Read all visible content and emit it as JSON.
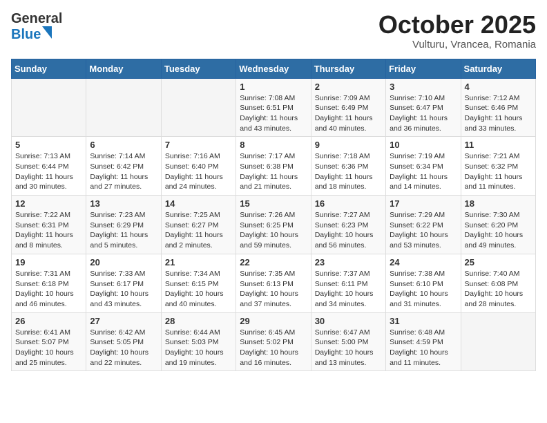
{
  "header": {
    "logo_general": "General",
    "logo_blue": "Blue",
    "month_title": "October 2025",
    "subtitle": "Vulturu, Vrancea, Romania"
  },
  "days_of_week": [
    "Sunday",
    "Monday",
    "Tuesday",
    "Wednesday",
    "Thursday",
    "Friday",
    "Saturday"
  ],
  "weeks": [
    [
      {
        "day": "",
        "info": ""
      },
      {
        "day": "",
        "info": ""
      },
      {
        "day": "",
        "info": ""
      },
      {
        "day": "1",
        "info": "Sunrise: 7:08 AM\nSunset: 6:51 PM\nDaylight: 11 hours\nand 43 minutes."
      },
      {
        "day": "2",
        "info": "Sunrise: 7:09 AM\nSunset: 6:49 PM\nDaylight: 11 hours\nand 40 minutes."
      },
      {
        "day": "3",
        "info": "Sunrise: 7:10 AM\nSunset: 6:47 PM\nDaylight: 11 hours\nand 36 minutes."
      },
      {
        "day": "4",
        "info": "Sunrise: 7:12 AM\nSunset: 6:46 PM\nDaylight: 11 hours\nand 33 minutes."
      }
    ],
    [
      {
        "day": "5",
        "info": "Sunrise: 7:13 AM\nSunset: 6:44 PM\nDaylight: 11 hours\nand 30 minutes."
      },
      {
        "day": "6",
        "info": "Sunrise: 7:14 AM\nSunset: 6:42 PM\nDaylight: 11 hours\nand 27 minutes."
      },
      {
        "day": "7",
        "info": "Sunrise: 7:16 AM\nSunset: 6:40 PM\nDaylight: 11 hours\nand 24 minutes."
      },
      {
        "day": "8",
        "info": "Sunrise: 7:17 AM\nSunset: 6:38 PM\nDaylight: 11 hours\nand 21 minutes."
      },
      {
        "day": "9",
        "info": "Sunrise: 7:18 AM\nSunset: 6:36 PM\nDaylight: 11 hours\nand 18 minutes."
      },
      {
        "day": "10",
        "info": "Sunrise: 7:19 AM\nSunset: 6:34 PM\nDaylight: 11 hours\nand 14 minutes."
      },
      {
        "day": "11",
        "info": "Sunrise: 7:21 AM\nSunset: 6:32 PM\nDaylight: 11 hours\nand 11 minutes."
      }
    ],
    [
      {
        "day": "12",
        "info": "Sunrise: 7:22 AM\nSunset: 6:31 PM\nDaylight: 11 hours\nand 8 minutes."
      },
      {
        "day": "13",
        "info": "Sunrise: 7:23 AM\nSunset: 6:29 PM\nDaylight: 11 hours\nand 5 minutes."
      },
      {
        "day": "14",
        "info": "Sunrise: 7:25 AM\nSunset: 6:27 PM\nDaylight: 11 hours\nand 2 minutes."
      },
      {
        "day": "15",
        "info": "Sunrise: 7:26 AM\nSunset: 6:25 PM\nDaylight: 10 hours\nand 59 minutes."
      },
      {
        "day": "16",
        "info": "Sunrise: 7:27 AM\nSunset: 6:23 PM\nDaylight: 10 hours\nand 56 minutes."
      },
      {
        "day": "17",
        "info": "Sunrise: 7:29 AM\nSunset: 6:22 PM\nDaylight: 10 hours\nand 53 minutes."
      },
      {
        "day": "18",
        "info": "Sunrise: 7:30 AM\nSunset: 6:20 PM\nDaylight: 10 hours\nand 49 minutes."
      }
    ],
    [
      {
        "day": "19",
        "info": "Sunrise: 7:31 AM\nSunset: 6:18 PM\nDaylight: 10 hours\nand 46 minutes."
      },
      {
        "day": "20",
        "info": "Sunrise: 7:33 AM\nSunset: 6:17 PM\nDaylight: 10 hours\nand 43 minutes."
      },
      {
        "day": "21",
        "info": "Sunrise: 7:34 AM\nSunset: 6:15 PM\nDaylight: 10 hours\nand 40 minutes."
      },
      {
        "day": "22",
        "info": "Sunrise: 7:35 AM\nSunset: 6:13 PM\nDaylight: 10 hours\nand 37 minutes."
      },
      {
        "day": "23",
        "info": "Sunrise: 7:37 AM\nSunset: 6:11 PM\nDaylight: 10 hours\nand 34 minutes."
      },
      {
        "day": "24",
        "info": "Sunrise: 7:38 AM\nSunset: 6:10 PM\nDaylight: 10 hours\nand 31 minutes."
      },
      {
        "day": "25",
        "info": "Sunrise: 7:40 AM\nSunset: 6:08 PM\nDaylight: 10 hours\nand 28 minutes."
      }
    ],
    [
      {
        "day": "26",
        "info": "Sunrise: 6:41 AM\nSunset: 5:07 PM\nDaylight: 10 hours\nand 25 minutes."
      },
      {
        "day": "27",
        "info": "Sunrise: 6:42 AM\nSunset: 5:05 PM\nDaylight: 10 hours\nand 22 minutes."
      },
      {
        "day": "28",
        "info": "Sunrise: 6:44 AM\nSunset: 5:03 PM\nDaylight: 10 hours\nand 19 minutes."
      },
      {
        "day": "29",
        "info": "Sunrise: 6:45 AM\nSunset: 5:02 PM\nDaylight: 10 hours\nand 16 minutes."
      },
      {
        "day": "30",
        "info": "Sunrise: 6:47 AM\nSunset: 5:00 PM\nDaylight: 10 hours\nand 13 minutes."
      },
      {
        "day": "31",
        "info": "Sunrise: 6:48 AM\nSunset: 4:59 PM\nDaylight: 10 hours\nand 11 minutes."
      },
      {
        "day": "",
        "info": ""
      }
    ]
  ]
}
